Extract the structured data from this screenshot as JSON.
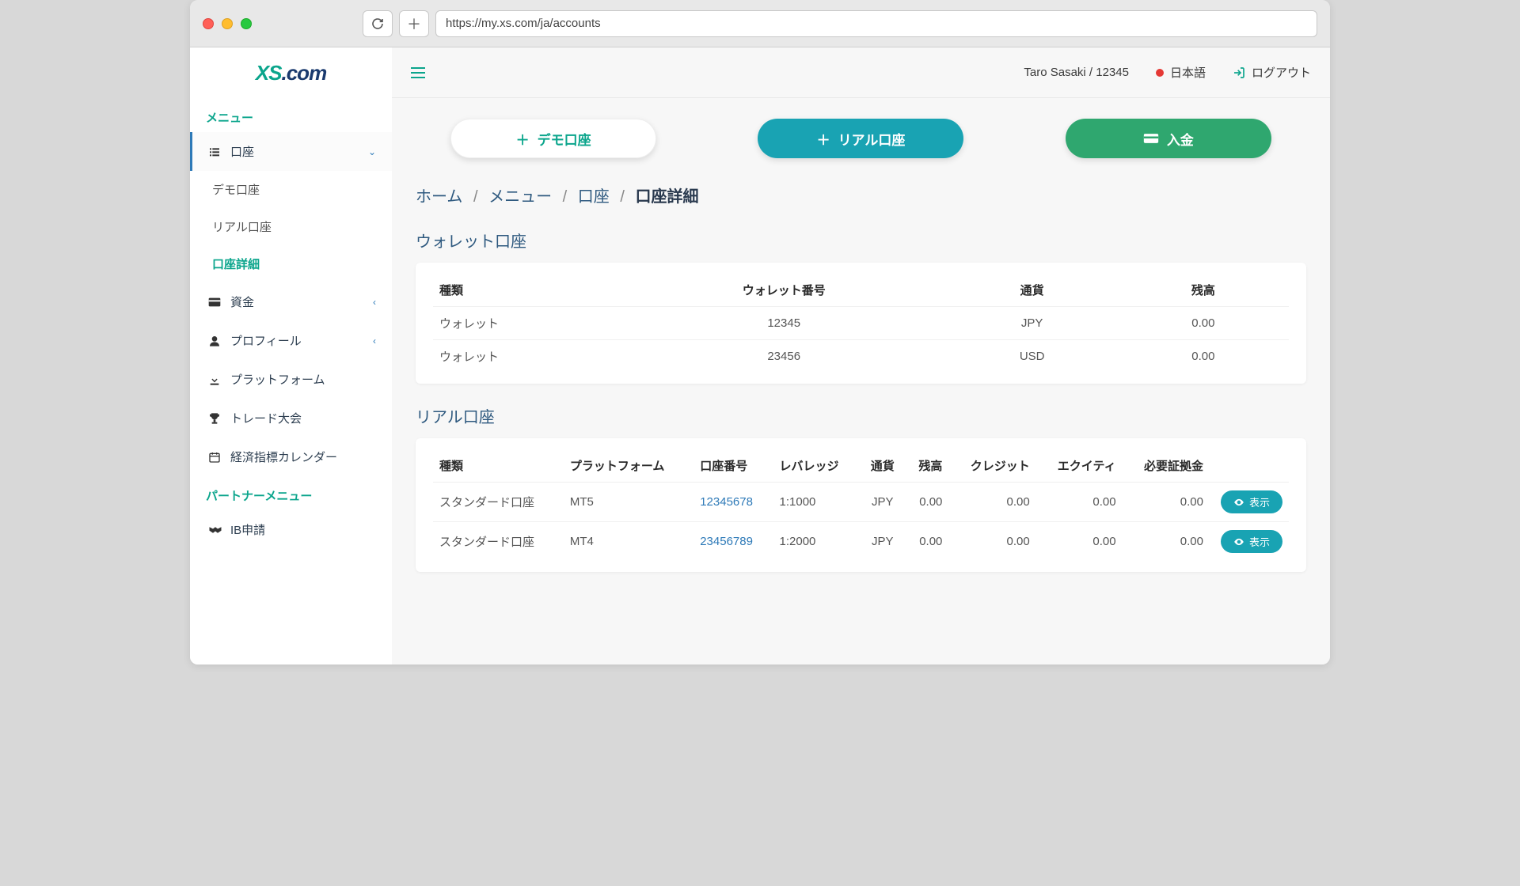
{
  "browser": {
    "url": "https://my.xs.com/ja/accounts"
  },
  "logo": {
    "xs": "XS",
    "com": ".com"
  },
  "sidebar": {
    "menu_label": "メニュー",
    "partner_label": "パートナーメニュー",
    "items": {
      "accounts": "口座",
      "sub_demo": "デモ口座",
      "sub_real": "リアル口座",
      "sub_detail": "口座詳細",
      "funds": "資金",
      "profile": "プロフィール",
      "platform": "プラットフォーム",
      "competition": "トレード大会",
      "calendar": "経済指標カレンダー",
      "ib": "IB申請"
    }
  },
  "topbar": {
    "user": "Taro Sasaki / 12345",
    "lang": "日本語",
    "logout": "ログアウト"
  },
  "cta": {
    "demo": "デモ口座",
    "real": "リアル口座",
    "deposit": "入金"
  },
  "breadcrumb": {
    "home": "ホーム",
    "menu": "メニュー",
    "accounts": "口座",
    "detail": "口座詳細"
  },
  "wallet": {
    "title": "ウォレット口座",
    "headers": {
      "type": "種類",
      "number": "ウォレット番号",
      "currency": "通貨",
      "balance": "残高"
    },
    "rows": [
      {
        "type": "ウォレット",
        "number": "12345",
        "currency": "JPY",
        "balance": "0.00"
      },
      {
        "type": "ウォレット",
        "number": "23456",
        "currency": "USD",
        "balance": "0.00"
      }
    ]
  },
  "real": {
    "title": "リアル口座",
    "headers": {
      "type": "種類",
      "platform": "プラットフォーム",
      "number": "口座番号",
      "leverage": "レバレッジ",
      "currency": "通貨",
      "balance": "残高",
      "credit": "クレジット",
      "equity": "エクイティ",
      "margin": "必要証拠金"
    },
    "show": "表示",
    "rows": [
      {
        "type": "スタンダード口座",
        "platform": "MT5",
        "number": "12345678",
        "leverage": "1:1000",
        "currency": "JPY",
        "balance": "0.00",
        "credit": "0.00",
        "equity": "0.00",
        "margin": "0.00"
      },
      {
        "type": "スタンダード口座",
        "platform": "MT4",
        "number": "23456789",
        "leverage": "1:2000",
        "currency": "JPY",
        "balance": "0.00",
        "credit": "0.00",
        "equity": "0.00",
        "margin": "0.00"
      }
    ]
  }
}
